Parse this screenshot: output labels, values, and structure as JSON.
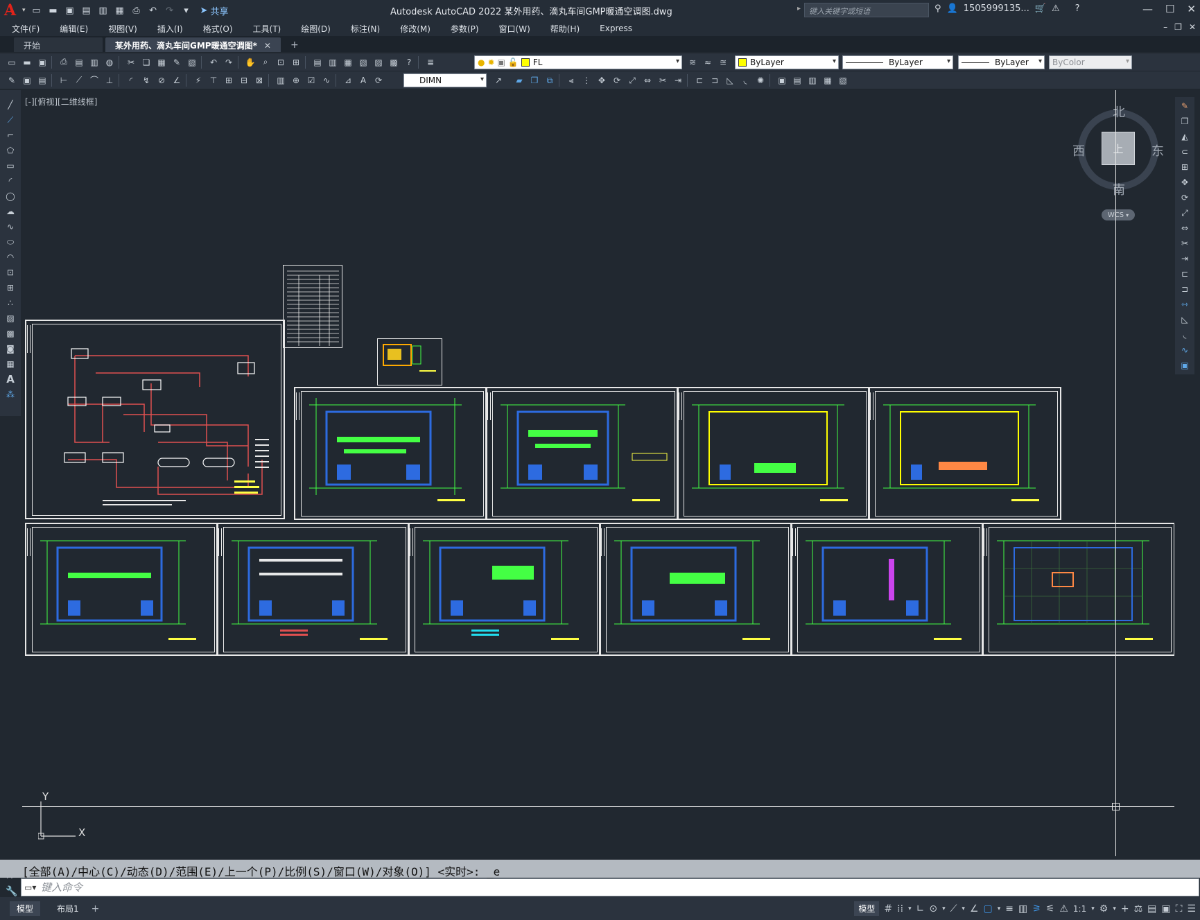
{
  "app": {
    "window_title": "Autodesk AutoCAD 2022    某外用药、滴丸车间GMP暖通空调图.dwg",
    "search_placeholder": "键入关键字或短语",
    "user": "1505999135...",
    "share": "共享"
  },
  "menu": [
    "文件(F)",
    "编辑(E)",
    "视图(V)",
    "插入(I)",
    "格式(O)",
    "工具(T)",
    "绘图(D)",
    "标注(N)",
    "修改(M)",
    "参数(P)",
    "窗口(W)",
    "帮助(H)",
    "Express"
  ],
  "tabs": {
    "start": "开始",
    "active": "某外用药、滴丸车间GMP暖通空调图*"
  },
  "toolbar": {
    "layer": "FL",
    "color": "ByLayer",
    "linetype": "ByLayer",
    "lineweight": "ByLayer",
    "plotstyle": "ByColor",
    "dimstyle": "DIMN",
    "colors": {
      "layer_swatch": "#ffff00",
      "color_swatch": "#ffff00"
    }
  },
  "viewport": {
    "label": "[-][俯视][二维线框]",
    "compass": {
      "north": "北",
      "south": "南",
      "east": "东",
      "west": "西",
      "face": "上"
    },
    "wcs": "WCS",
    "ucs_x": "X",
    "ucs_y": "Y"
  },
  "command": {
    "history": "[全部(A)/中心(C)/动态(D)/范围(E)/上一个(P)/比例(S)/窗口(W)/对象(O)] <实时>: _e",
    "placeholder": "键入命令"
  },
  "status": {
    "model_tab": "模型",
    "layout_tab": "布局1",
    "model_space": "模型",
    "scale": "1:1"
  }
}
